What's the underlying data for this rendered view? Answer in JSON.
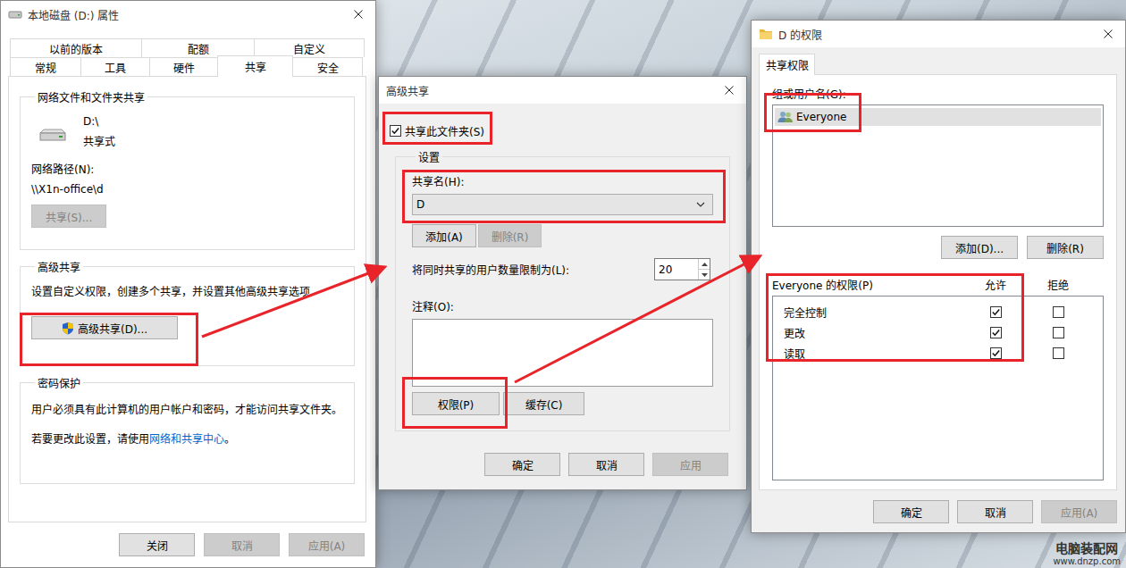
{
  "properties": {
    "title": "本地磁盘 (D:) 属性",
    "tabs_back": [
      {
        "label": "以前的版本",
        "selected": false
      },
      {
        "label": "配额",
        "selected": false
      },
      {
        "label": "自定义",
        "selected": false
      }
    ],
    "tabs_front": [
      {
        "label": "常规",
        "selected": false
      },
      {
        "label": "工具",
        "selected": false
      },
      {
        "label": "硬件",
        "selected": false
      },
      {
        "label": "共享",
        "selected": true
      },
      {
        "label": "安全",
        "selected": false
      }
    ],
    "share_group": {
      "legend": "网络文件和文件夹共享",
      "drive_name": "D:\\",
      "drive_status": "共享式",
      "path_label": "网络路径(N):",
      "path": "\\\\X1n-office\\d",
      "share_button": {
        "label": "共享(S)...",
        "disabled": true
      }
    },
    "advanced_group": {
      "legend": "高级共享",
      "description": "设置自定义权限，创建多个共享，并设置其他高级共享选项",
      "button": {
        "label": "高级共享(D)...",
        "disabled": false
      }
    },
    "password_group": {
      "legend": "密码保护",
      "text": "用户必须具有此计算机的用户帐户和密码，才能访问共享文件夹。",
      "change_prefix": "若要更改此设置，请使用",
      "link": "网络和共享中心",
      "change_suffix": "。"
    },
    "buttons": [
      {
        "label": "关闭",
        "disabled": false
      },
      {
        "label": "取消",
        "disabled": true
      },
      {
        "label": "应用(A)",
        "disabled": true
      }
    ]
  },
  "advanced": {
    "title": "高级共享",
    "share_checkbox": {
      "label": "共享此文件夹(S)",
      "checked": true
    },
    "settings_legend": "设置",
    "share_name_label": "共享名(H):",
    "share_name": "D",
    "add_button": {
      "label": "添加(A)",
      "disabled": false
    },
    "remove_button": {
      "label": "删除(R)",
      "disabled": true
    },
    "limit_label": "将同时共享的用户数量限制为(L):",
    "limit_value": "20",
    "comment_label": "注释(O):",
    "comment": "",
    "permissions_button": {
      "label": "权限(P)",
      "disabled": false
    },
    "cache_button": {
      "label": "缓存(C)",
      "disabled": false
    },
    "buttons": [
      {
        "label": "确定",
        "disabled": false
      },
      {
        "label": "取消",
        "disabled": false
      },
      {
        "label": "应用",
        "disabled": true
      }
    ]
  },
  "permissions": {
    "title": "D 的权限",
    "tab": {
      "label": "共享权限",
      "selected": true
    },
    "users_label": "组或用户名(G):",
    "users": [
      {
        "name": "Everyone",
        "selected": true
      }
    ],
    "add_button": {
      "label": "添加(D)...",
      "disabled": false
    },
    "remove_button": {
      "label": "删除(R)",
      "disabled": false
    },
    "perm_header": "Everyone 的权限(P)",
    "allow_header": "允许",
    "deny_header": "拒绝",
    "perms": [
      {
        "name": "完全控制",
        "allow": true,
        "deny": false
      },
      {
        "name": "更改",
        "allow": true,
        "deny": false
      },
      {
        "name": "读取",
        "allow": true,
        "deny": false
      }
    ],
    "buttons": [
      {
        "label": "确定",
        "disabled": false
      },
      {
        "label": "取消",
        "disabled": false
      },
      {
        "label": "应用(A)",
        "disabled": true
      }
    ]
  },
  "watermark": {
    "name": "电脑装配网",
    "url": "www.dnzp.com"
  }
}
